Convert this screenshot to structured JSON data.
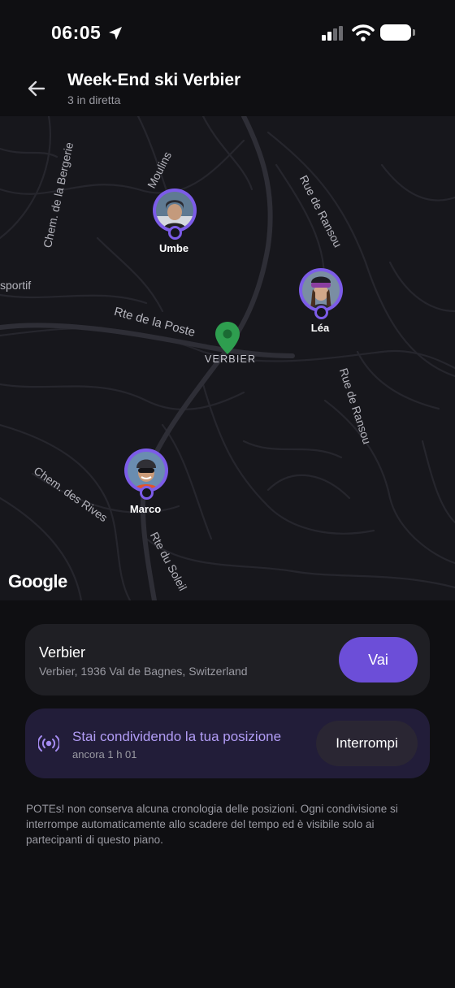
{
  "status_bar": {
    "time": "06:05"
  },
  "header": {
    "title": "Week-End ski Verbier",
    "subtitle": "3 in diretta"
  },
  "map": {
    "street_labels": [
      "Chem. de la Bergerie",
      "Moulins",
      "Rue de Ransou",
      "sportif",
      "Rte de la Poste",
      "Rue de Ransou",
      "Chem. des Rives",
      "Rte du Soleil"
    ],
    "place_label": "VERBIER",
    "attribution": "Google",
    "participants": [
      {
        "name": "Umbe"
      },
      {
        "name": "Léa"
      },
      {
        "name": "Marco"
      }
    ]
  },
  "place": {
    "name": "Verbier",
    "address": "Verbier, 1936 Val de Bagnes, Switzerland",
    "go_label": "Vai"
  },
  "sharing": {
    "title": "Stai condividendo la tua posizione",
    "remaining": "ancora 1 h 01",
    "stop_label": "Interrompi"
  },
  "disclaimer": "POTEs! non conserva alcuna cronologia delle posizioni. Ogni condivisione si interrompe automaticamente allo scadere del tempo ed è visibile solo ai partecipanti di questo piano.",
  "colors": {
    "accent": "#6c4ed8",
    "pin_ring": "#7c5ce8",
    "place_marker": "#2e9e4f"
  },
  "icons": [
    "location-arrow-icon",
    "signal-icon",
    "wifi-icon",
    "battery-icon",
    "back-arrow-icon",
    "broadcast-icon",
    "map-pin-icon"
  ]
}
